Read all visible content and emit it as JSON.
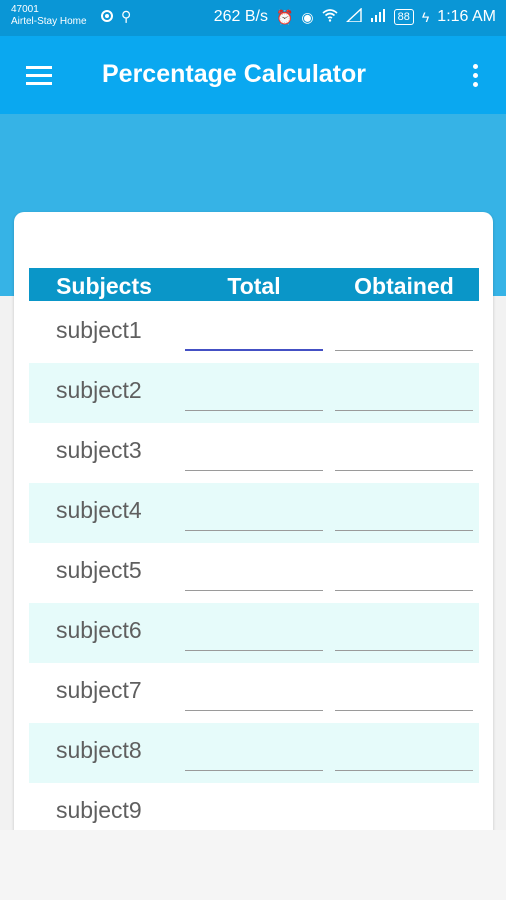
{
  "status_bar": {
    "carrier": "47001",
    "network": "Airtel-Stay Home",
    "speed": "262 B/s",
    "battery": "88",
    "time": "1:16 AM",
    "icons": [
      "notification-dot-icon",
      "usb-icon",
      "alarm-icon",
      "eye-icon",
      "wifi-icon",
      "signal-icon",
      "signal-icon",
      "battery-icon",
      "charging-icon"
    ]
  },
  "appbar": {
    "title": "Percentage Calculator",
    "menu_icon": "hamburger-menu-icon",
    "overflow_icon": "more-vertical-icon"
  },
  "colors": {
    "status_bar": "#0a96d6",
    "appbar": "#0aa8f0",
    "banner": "#36b3e6",
    "table_header": "#0a96c8",
    "row_alt": "#e6fbfa",
    "focus_underline": "#4450c4"
  },
  "table": {
    "headers": [
      "Subjects",
      "Total",
      "Obtained"
    ],
    "rows": [
      {
        "subject": "subject1",
        "total": "",
        "obtained": ""
      },
      {
        "subject": "subject2",
        "total": "",
        "obtained": ""
      },
      {
        "subject": "subject3",
        "total": "",
        "obtained": ""
      },
      {
        "subject": "subject4",
        "total": "",
        "obtained": ""
      },
      {
        "subject": "subject5",
        "total": "",
        "obtained": ""
      },
      {
        "subject": "subject6",
        "total": "",
        "obtained": ""
      },
      {
        "subject": "subject7",
        "total": "",
        "obtained": ""
      },
      {
        "subject": "subject8",
        "total": "",
        "obtained": ""
      },
      {
        "subject": "subject9",
        "total": "",
        "obtained": ""
      }
    ]
  }
}
